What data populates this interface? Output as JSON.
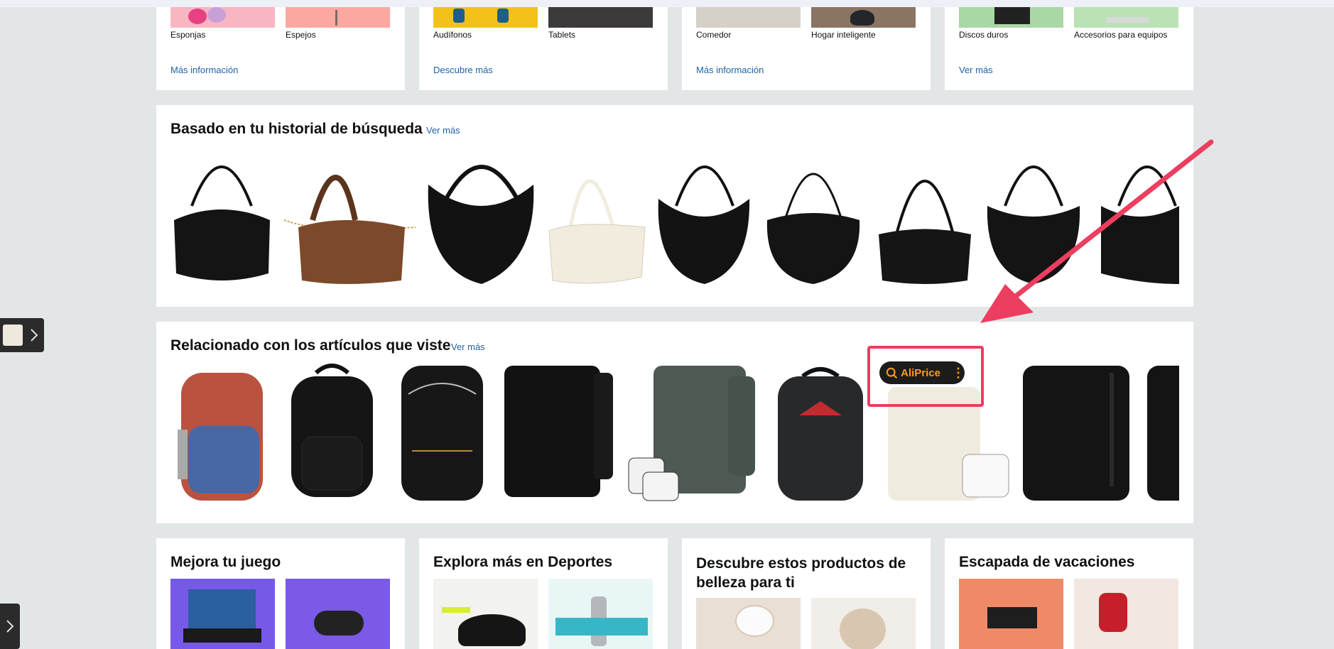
{
  "top_cards": [
    {
      "tiles": [
        "Esponjas",
        "Espejos"
      ],
      "link": "Más información"
    },
    {
      "tiles": [
        "Audífonos",
        "Tablets"
      ],
      "link": "Descubre más"
    },
    {
      "tiles": [
        "Comedor",
        "Hogar inteligente"
      ],
      "link": "Más información"
    },
    {
      "tiles": [
        "Discos duros",
        "Accesorios para equipos"
      ],
      "link": "Ver más"
    }
  ],
  "search_history": {
    "title": "Basado en tu historial de búsqueda",
    "link": "Ver más",
    "items": [
      "black-handbag",
      "brown-handbag-chain",
      "black-hobo-bag",
      "cream-baguette-bag",
      "black-shoulder-bag",
      "black-shoulder-bag",
      "black-baguette-bag",
      "black-hobo-bag",
      "black-hobo-bag"
    ]
  },
  "related": {
    "title": "Relacionado con los artículos que viste",
    "link": "Ver más",
    "items": [
      "red-blue-backpack",
      "black-backpack",
      "black-laptop-backpack",
      "black-travel-backpack",
      "green-travel-backpack",
      "black-red-logo-backpack",
      "cream-travel-backpack",
      "black-large-backpack",
      "black-backpack"
    ]
  },
  "aliprice": {
    "label": "AliPrice"
  },
  "bottom_cards": [
    {
      "title": "Mejora tu juego"
    },
    {
      "title": "Explora más en Deportes"
    },
    {
      "title": "Descubre estos productos de belleza para ti"
    },
    {
      "title": "Escapada de vacaciones"
    }
  ],
  "colors": {
    "accent_link": "#2162a1",
    "aliprice_orange": "#ff9a1f",
    "highlight_red": "#ec3e5f"
  }
}
